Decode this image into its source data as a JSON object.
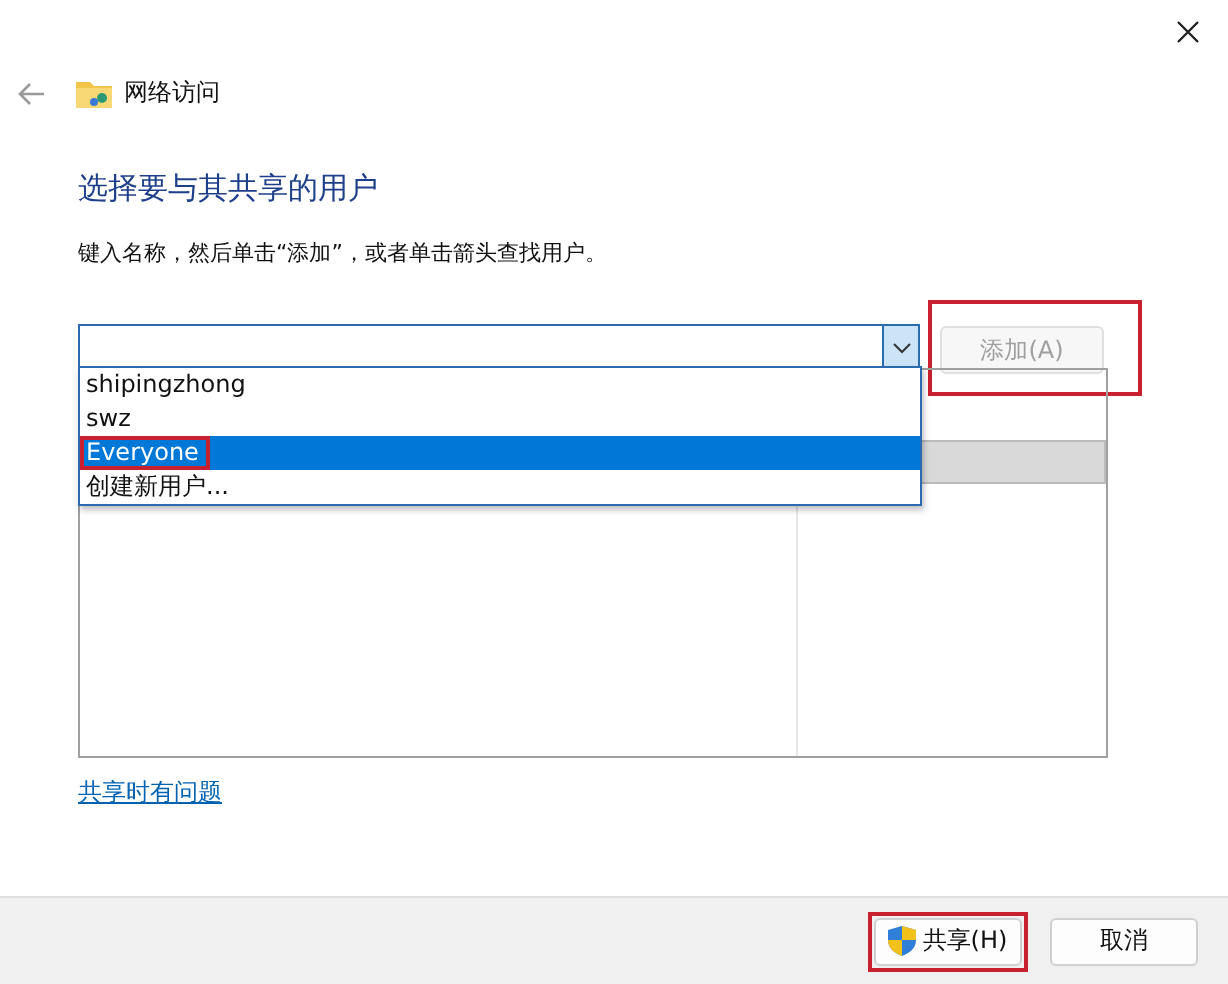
{
  "window": {
    "title": "网络访问"
  },
  "heading": "选择要与其共享的用户",
  "instruction": "键入名称，然后单击“添加”，或者单击箭头查找用户。",
  "combo": {
    "expanded": true,
    "options": [
      {
        "label": "shipingzhong",
        "selected": false,
        "highlighted": false
      },
      {
        "label": "swz",
        "selected": false,
        "highlighted": false
      },
      {
        "label": "Everyone",
        "selected": true,
        "highlighted": true
      },
      {
        "label": "创建新用户...",
        "selected": false,
        "highlighted": false
      }
    ]
  },
  "add_button": {
    "label": "添加(A)",
    "disabled": true,
    "highlighted": true
  },
  "link": "共享时有问题",
  "buttons": [
    {
      "label": "共享(H)",
      "kind": "shield",
      "highlighted": true
    },
    {
      "label": "取消",
      "kind": "plain",
      "highlighted": false
    }
  ]
}
